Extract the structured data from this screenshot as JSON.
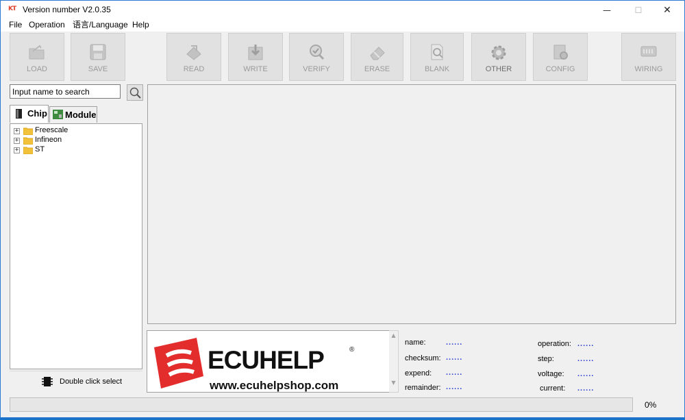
{
  "window": {
    "app_logo": "KT",
    "title": "Version number  V2.0.35",
    "minimize": "—",
    "maximize": "☐",
    "close": "✕"
  },
  "menu": [
    "File",
    "Operation",
    "语言/Language",
    "Help"
  ],
  "toolbar": {
    "load": "LOAD",
    "save": "SAVE",
    "read": "READ",
    "write": "WRITE",
    "verify": "VERIFY",
    "erase": "ERASE",
    "blank": "BLANK",
    "other": "OTHER",
    "config": "CONFIG",
    "wiring": "WIRING"
  },
  "search": {
    "value": "Input name to search"
  },
  "tabs": {
    "chip": "Chip",
    "module": "Module"
  },
  "tree": [
    "Freescale",
    "Infineon",
    "ST"
  ],
  "double_click_select": "Double click select",
  "brand": {
    "name": "ECUHELP",
    "registered": "®",
    "url": "www.ecuhelpshop.com",
    "color": "#e32c2c"
  },
  "info": {
    "name_label": "name:",
    "name_value": "......",
    "checksum_label": "checksum:",
    "checksum_value": "......",
    "expend_label": "expend:",
    "expend_value": "......",
    "remainder_label": "remainder:",
    "remainder_value": "......",
    "operation_label": "operation:",
    "operation_value": "......",
    "step_label": "step:",
    "step_value": "......",
    "voltage_label": "voltage:",
    "voltage_value": "......",
    "current_label": "current:",
    "current_value": "......"
  },
  "status": {
    "progress": "0%",
    "progress_value": 0
  }
}
